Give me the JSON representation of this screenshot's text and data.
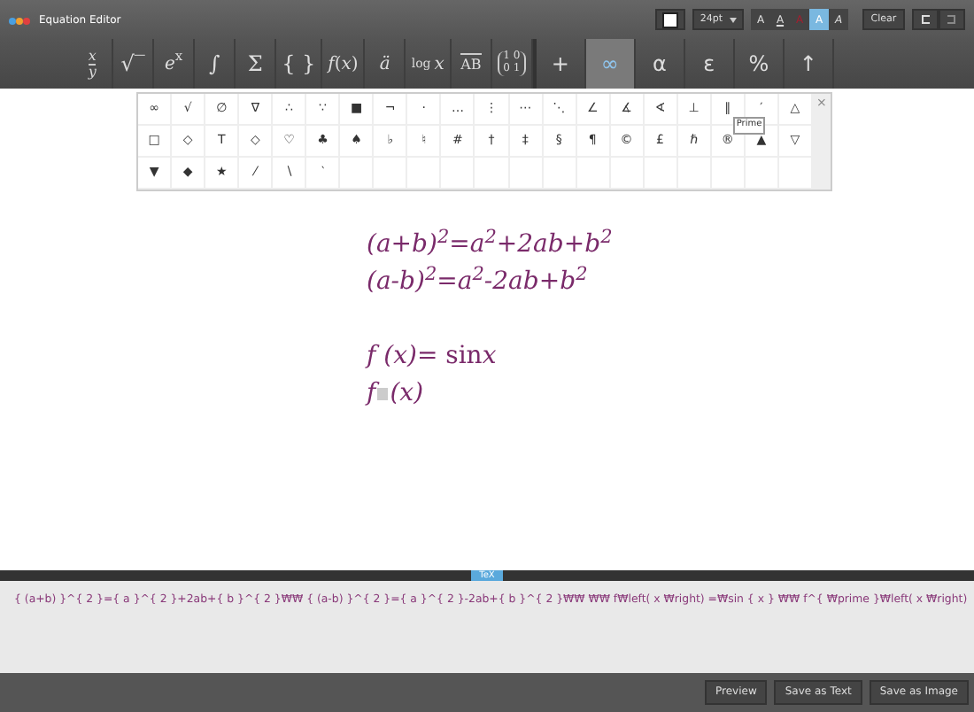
{
  "window": {
    "title": "Equation Editor"
  },
  "format_bar": {
    "font_size": "24pt",
    "styles": [
      {
        "label": "A",
        "kind": "plain",
        "selected": false
      },
      {
        "label": "A",
        "kind": "underline",
        "selected": false
      },
      {
        "label": "A",
        "kind": "red",
        "selected": false
      },
      {
        "label": "A",
        "kind": "plain",
        "selected": true
      },
      {
        "label": "A",
        "kind": "italic",
        "selected": false
      }
    ],
    "clear": "Clear"
  },
  "toolbar": {
    "templates": [
      {
        "kind": "fraction",
        "top": "x",
        "bottom": "y",
        "selected": false
      },
      {
        "kind": "text",
        "label": "√‾",
        "selected": false
      },
      {
        "kind": "rich",
        "label": "*e*$^{x}$",
        "selected": false
      },
      {
        "kind": "text",
        "label": "∫",
        "selected": false
      },
      {
        "kind": "text",
        "label": "Σ",
        "selected": false
      },
      {
        "kind": "text",
        "label": "{ }",
        "selected": false
      },
      {
        "kind": "rich",
        "label": "*f*(*x*)",
        "selected": false
      },
      {
        "kind": "rich",
        "label": "*ä*",
        "selected": false
      },
      {
        "kind": "func",
        "fn": "log",
        "arg": "x",
        "selected": false
      },
      {
        "kind": "vector",
        "label": "AB",
        "selected": false
      },
      {
        "kind": "matrix",
        "rows": [
          "1 0",
          "0 1"
        ],
        "selected": false
      }
    ],
    "categories": [
      {
        "kind": "text",
        "label": "+",
        "selected": false
      },
      {
        "kind": "text",
        "label": "∞",
        "selected": true
      },
      {
        "kind": "text",
        "label": "α",
        "selected": false
      },
      {
        "kind": "text",
        "label": "ε",
        "selected": false
      },
      {
        "kind": "text",
        "label": "%",
        "selected": false
      },
      {
        "kind": "text",
        "label": "↑",
        "selected": false
      }
    ]
  },
  "symbol_panel": {
    "close": "×",
    "tooltip": "Prime",
    "rows": [
      [
        "∞",
        "√",
        "∅",
        "∇",
        "∴",
        "∵",
        "■",
        "¬",
        "·",
        "…",
        "⋮",
        "⋯",
        "⋱",
        "∠",
        "∡",
        "∢",
        "⊥",
        "∥",
        "′",
        "△"
      ],
      [
        "□",
        "◇",
        "T",
        "◇",
        "♡",
        "♣",
        "♠",
        "♭",
        "♮",
        "#",
        "†",
        "‡",
        "§",
        "¶",
        "©",
        "£",
        "ℏ",
        "®",
        "▲",
        "▽"
      ],
      [
        "▼",
        "◆",
        "★",
        "⁄",
        "∖",
        "‵"
      ]
    ]
  },
  "equations": [
    {
      "kind": "formula",
      "text": "(a+b)$^{2}$=a$^{2}$+2ab+b$^{2}$"
    },
    {
      "kind": "formula",
      "text": "(a-b)$^{2}$=a$^{2}$-2ab+b$^{2}$"
    },
    {
      "kind": "blank"
    },
    {
      "kind": "mixed",
      "parts": [
        {
          "text": "f (x)= ",
          "italic": true
        },
        {
          "text": "sin",
          "italic": false
        },
        {
          "text": "x",
          "italic": true
        }
      ]
    },
    {
      "kind": "slot",
      "before": "*f*",
      "after": "(*x*)"
    }
  ],
  "tex_tab": "TeX",
  "tex_source": "{ (a+b) }^{ 2 }={ a }^{ 2 }+2ab+{ b }^{ 2 }₩₩ { (a-b) }^{ 2 }={ a }^{ 2 }-2ab+{ b }^{ 2 }₩₩ ₩₩ f₩left( x ₩right) =₩sin { x } ₩₩ f^{ ₩prime }₩left( x ₩right)",
  "buttons": [
    "Preview",
    "Save as Text",
    "Save as Image"
  ]
}
